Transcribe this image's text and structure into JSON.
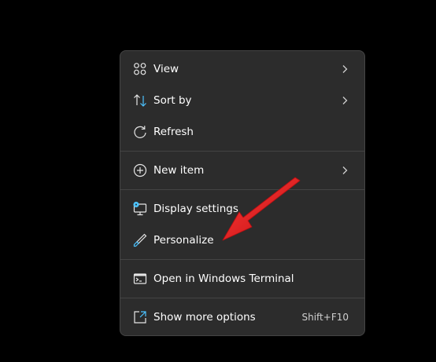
{
  "menu": {
    "items": [
      {
        "label": "View",
        "icon": "grid-icon",
        "has_submenu": true
      },
      {
        "label": "Sort by",
        "icon": "sort-icon",
        "has_submenu": true
      },
      {
        "label": "Refresh",
        "icon": "refresh-icon",
        "has_submenu": false
      },
      {
        "label": "New item",
        "icon": "plus-circle-icon",
        "has_submenu": true
      },
      {
        "label": "Display settings",
        "icon": "monitor-settings-icon",
        "has_submenu": false
      },
      {
        "label": "Personalize",
        "icon": "brush-icon",
        "has_submenu": false
      },
      {
        "label": "Open in Windows Terminal",
        "icon": "terminal-icon",
        "has_submenu": false
      },
      {
        "label": "Show more options",
        "icon": "more-options-icon",
        "has_submenu": false,
        "shortcut": "Shift+F10"
      }
    ]
  },
  "colors": {
    "background": "#000000",
    "menu_bg": "#2c2c2c",
    "menu_border": "#454545",
    "text": "#ffffff",
    "arrow": "#e0191b",
    "accent_icon": "#4cc2ff"
  }
}
